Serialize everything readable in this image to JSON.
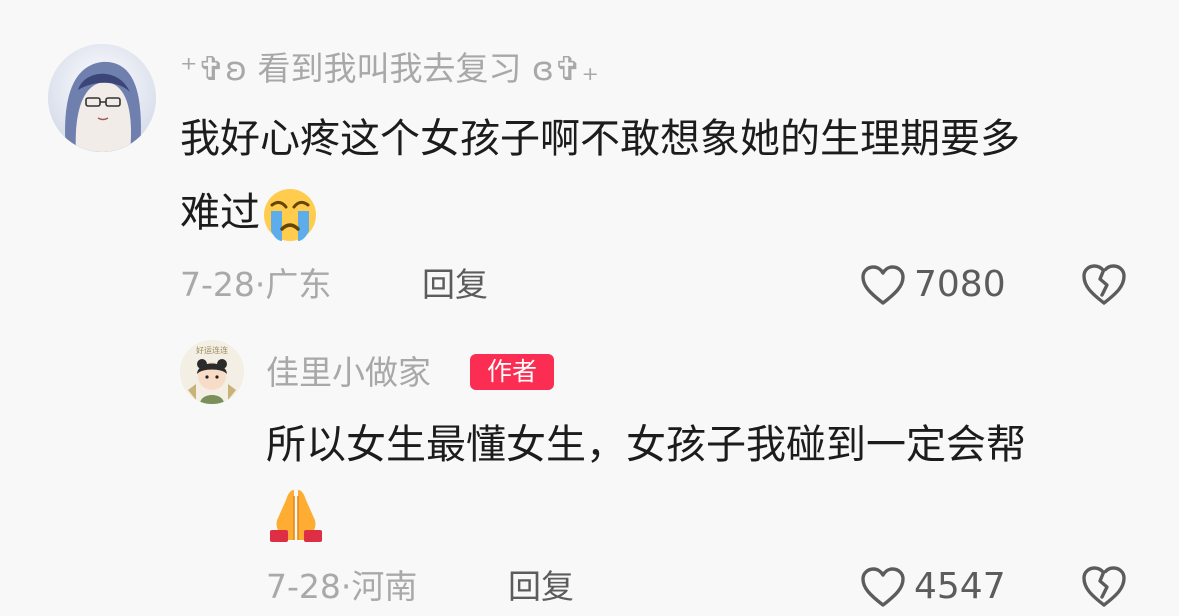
{
  "comments": [
    {
      "author": "⁺✞ʚ 看到我叫我去复习 ɞ✞₊",
      "content_line1": "我好心疼这个女孩子啊不敢想象她的生理期要多",
      "content_line2": "难过",
      "emoji": "crying-face",
      "date": "7-28",
      "separator": "·",
      "location": "广东",
      "reply_label": "回复",
      "likes": "7080"
    },
    {
      "author": "佳里小做家",
      "badge": "作者",
      "content_line1": "所以女生最懂女生，女孩子我碰到一定会帮",
      "emoji": "folded-hands",
      "date": "7-28",
      "separator": "·",
      "location": "河南",
      "reply_label": "回复",
      "likes": "4547"
    }
  ],
  "colors": {
    "background": "#f8f8f8",
    "badge": "#fb2d52",
    "muted_text": "#a8a8a8",
    "action_text": "#5c5c5c",
    "body_text": "#1c1c1c"
  }
}
